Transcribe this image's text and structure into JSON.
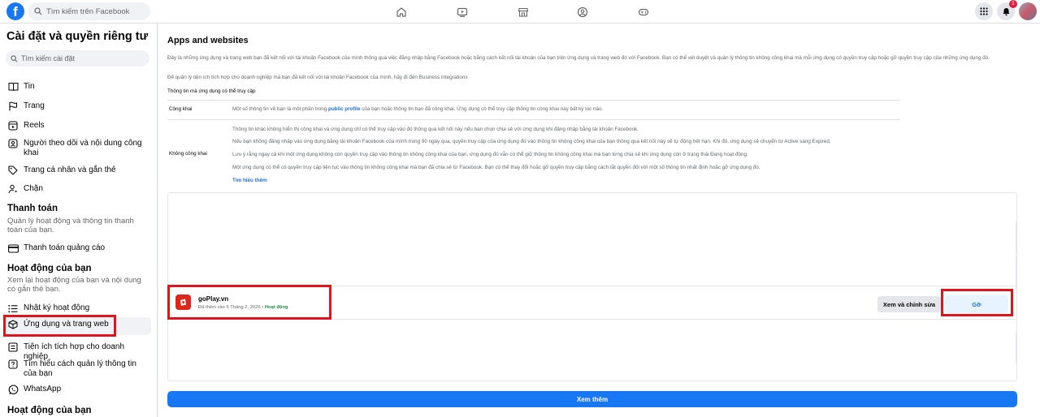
{
  "topbar": {
    "search_placeholder": "Tìm kiếm trên Facebook",
    "notification_count": "1"
  },
  "sidebar": {
    "title": "Cài đặt và quyền riêng tư",
    "search_placeholder": "Tìm kiếm cài đặt",
    "items_top": [
      {
        "label": "Tin",
        "icon": "book-icon"
      },
      {
        "label": "Trang",
        "icon": "flag-icon"
      },
      {
        "label": "Reels",
        "icon": "reels-icon"
      },
      {
        "label": "Người theo dõi và nội dung công khai",
        "icon": "followers-icon"
      },
      {
        "label": "Trang cá nhân và gắn thẻ",
        "icon": "tag-icon"
      },
      {
        "label": "Chặn",
        "icon": "block-user-icon"
      }
    ],
    "payments": {
      "heading": "Thanh toán",
      "description": "Quản lý hoạt động và thông tin thanh toán của bạn.",
      "items": [
        {
          "label": "Thanh toán quảng cáo",
          "icon": "credit-card-icon"
        }
      ]
    },
    "activity": {
      "heading": "Hoạt động của bạn",
      "description": "Xem lại hoạt động của bạn và nội dung có gắn thẻ bạn.",
      "items": [
        {
          "label": "Nhật ký hoạt động",
          "icon": "list-icon"
        },
        {
          "label": "Ứng dụng và trang web",
          "icon": "cube-icon",
          "active": true
        },
        {
          "label": "Tiện ích tích hợp cho doanh nghiệp",
          "icon": "integration-icon"
        },
        {
          "label": "Tìm hiểu cách quản lý thông tin của bạn",
          "icon": "help-icon"
        },
        {
          "label": "WhatsApp",
          "icon": "whatsapp-icon"
        }
      ]
    },
    "bottom_heading": "Hoạt động của bạn"
  },
  "main": {
    "title": "Apps and websites",
    "intro": "Đây là những ứng dụng và trang web bạn đã kết nối với tài khoản Facebook của mình thông qua việc đăng nhập bằng Facebook hoặc bằng cách kết nối tài khoản của bạn trên ứng dụng và trang web đó với Facebook. Bạn có thể xét duyệt và quản lý thông tin không công khai mà mỗi ứng dụng có quyền truy cập hoặc gỡ quyền truy cập của những ứng dụng đó.",
    "intro2": "Để quản lý tiện ích tích hợp cho doanh nghiệp mà bạn đã kết nối với tài khoản Facebook của mình, hãy đi đến Business integrations",
    "access_heading": "Thông tin mà ứng dụng có thể truy cập",
    "public": {
      "label": "Công khai",
      "text_before": "Một số thông tin về bạn là một phần trong",
      "link": "public profile",
      "text_after": "của bạn hoặc thông tin bạn đã công khai. Ứng dụng có thể truy cập thông tin công khai này bất kỳ lúc nào."
    },
    "private": {
      "label": "Không công khai",
      "lines": [
        "Thông tin khác không hiển thị công khai và ứng dụng chỉ có thể truy cập vào đó thông qua kết nối này nếu bạn chọn chia sẻ với ứng dụng khi đăng nhập bằng tài khoản Facebook.",
        "Nếu bạn không đăng nhập vào ứng dụng bằng tài khoản Facebook của mình trong 90 ngày qua, quyền truy cập của ứng dụng đó vào thông tin không công khai của bạn thông qua kết nối này sẽ tự động hết hạn. Khi đó, ứng dụng sẽ chuyển từ Active sang Expired.",
        "Lưu ý rằng ngay cả khi một ứng dụng không còn quyền truy cập vào thông tin không công khai của bạn, ứng dụng đó vẫn có thể giữ thông tin không công khai mà bạn từng chia sẻ khi ứng dụng còn ở trạng thái Đang hoạt động.",
        "Một ứng dụng có thể có quyền truy cập liên tục vào thông tin không công khai mà bạn đã chia sẻ từ Facebook. Bạn có thể thay đổi hoặc gỡ quyền truy cập bằng cách tắt quyền đối với một số thông tin nhất định hoặc gỡ ứng dụng đó."
      ],
      "learn_more": "Tìm hiểu thêm"
    },
    "app": {
      "name": "goPlay.vn",
      "added": "Đã thêm vào 5 Tháng 2, 2026",
      "separator": "•",
      "status": "Hoạt động",
      "view_button": "Xem và chỉnh sửa",
      "remove_button": "Gỡ"
    },
    "see_more": "Xem thêm"
  },
  "colors": {
    "brand": "#1877f2",
    "highlight_box": "#e0141e",
    "status_active": "#1b8f3f"
  }
}
